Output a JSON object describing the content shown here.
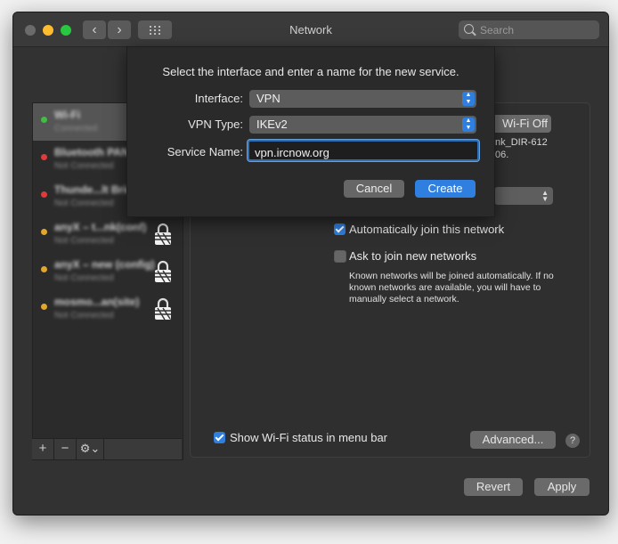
{
  "window": {
    "title": "Network"
  },
  "search": {
    "placeholder": "Search"
  },
  "toolbar": {
    "back_glyph": "‹",
    "forward_glyph": "›"
  },
  "sidebar": {
    "items": [
      {
        "name": "Wi-Fi",
        "status": "Connected",
        "status_color": "#3fbf3f",
        "locked": false,
        "selected": true
      },
      {
        "name": "Bluetooth PAN",
        "status": "Not Connected",
        "status_color": "#e03a3a",
        "locked": false,
        "selected": false
      },
      {
        "name": "Thunde...lt Bridge",
        "status": "Not Connected",
        "status_color": "#e03a3a",
        "locked": false,
        "selected": false
      },
      {
        "name": "anyX – t...nk(conf)",
        "status": "Not Connected",
        "status_color": "#e3a62a",
        "locked": true,
        "selected": false
      },
      {
        "name": "anyX – new (config)",
        "status": "Not Connected",
        "status_color": "#e3a62a",
        "locked": true,
        "selected": false
      },
      {
        "name": "mosmo...an(site)",
        "status": "Not Connected",
        "status_color": "#e3a62a",
        "locked": true,
        "selected": false
      }
    ],
    "add_label": "+",
    "remove_label": "−",
    "action_label": "⚙⌄"
  },
  "panel": {
    "wifi_off_label": "Wi-Fi Off",
    "network_fragment_1": "nk_DIR-612",
    "network_fragment_2": "06.",
    "auto_join_label": "Automatically join this network",
    "auto_join_checked": true,
    "ask_join_label": "Ask to join new networks",
    "ask_join_checked": false,
    "ask_join_note": "Known networks will be joined automatically. If no known networks are available, you will have to manually select a network.",
    "show_status_label": "Show Wi-Fi status in menu bar",
    "show_status_checked": true,
    "advanced_label": "Advanced...",
    "help_label": "?"
  },
  "footer": {
    "revert_label": "Revert",
    "apply_label": "Apply"
  },
  "sheet": {
    "heading": "Select the interface and enter a name for the new service.",
    "interface_label": "Interface:",
    "interface_value": "VPN",
    "vpn_type_label": "VPN Type:",
    "vpn_type_value": "IKEv2",
    "service_name_label": "Service Name:",
    "service_name_value": "vpn.ircnow.org",
    "cancel_label": "Cancel",
    "create_label": "Create"
  },
  "colors": {
    "accent": "#2f7fe0",
    "close": "#ff5f57",
    "minimize": "#febc2e",
    "zoom": "#28c840",
    "inactive_light": "#6b6b6b"
  }
}
